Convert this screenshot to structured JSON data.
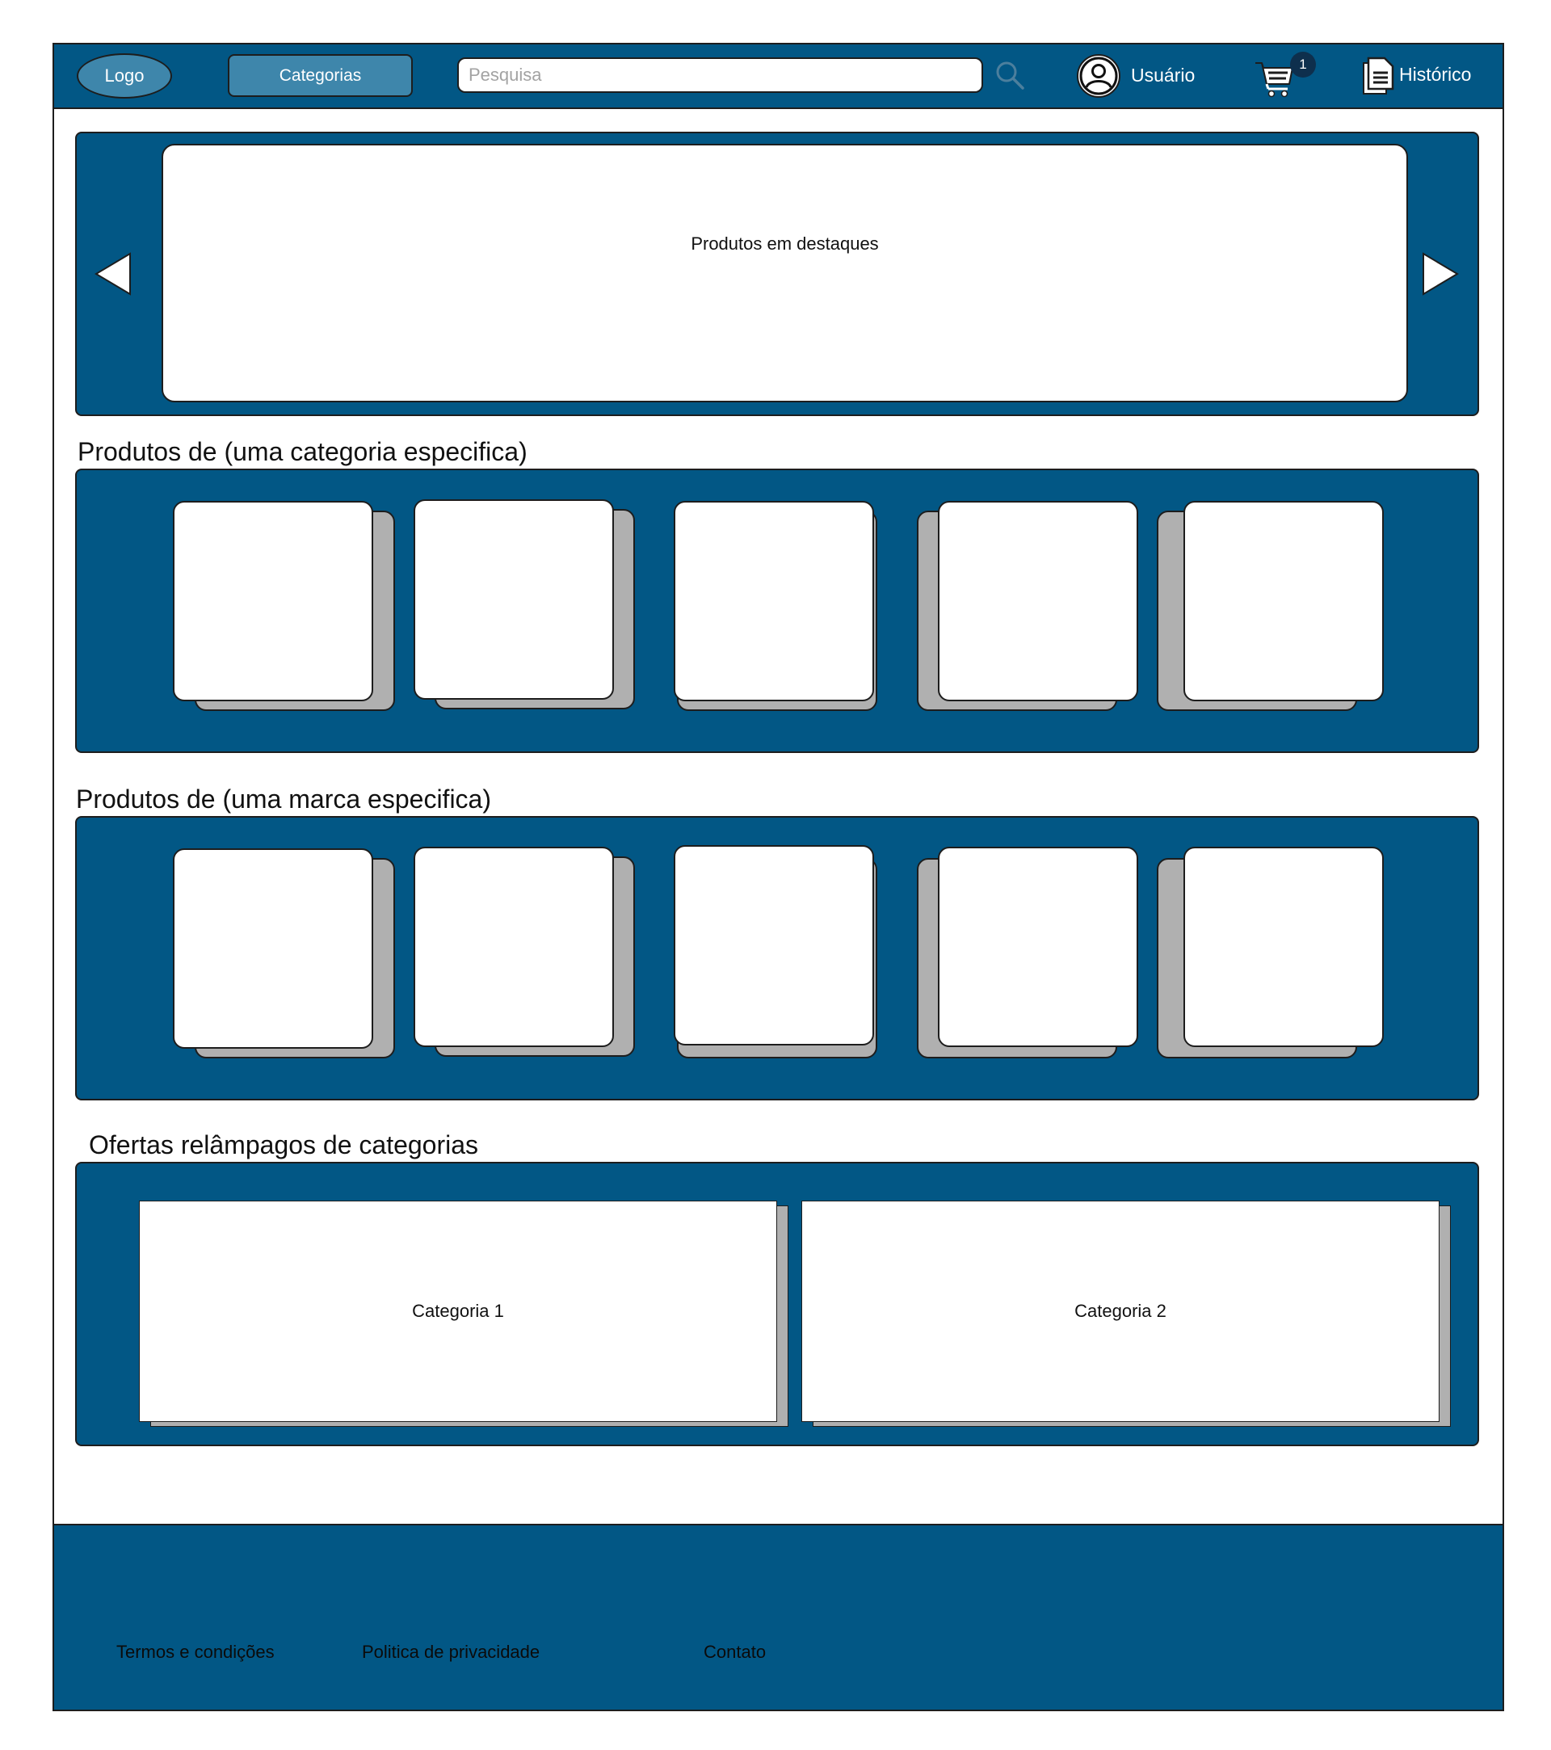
{
  "header": {
    "logo": "Logo",
    "categories_button": "Categorias",
    "search_placeholder": "Pesquisa",
    "user_label": "Usuário",
    "cart_count": "1",
    "history_label": "Histórico"
  },
  "hero": {
    "text": "Produtos em destaques"
  },
  "sections": {
    "category_title": "Produtos de (uma categoria especifica)",
    "brand_title": "Produtos de (uma marca especifica)",
    "flash_title": "Ofertas relâmpagos de categorias"
  },
  "flash": {
    "items": [
      "Categoria 1",
      "Categoria 2"
    ]
  },
  "footer": {
    "terms": "Termos e condições",
    "privacy": "Politica de privacidade",
    "contact": "Contato"
  },
  "colors": {
    "primary": "#025785",
    "button": "#3e86ab",
    "card_shadow": "#b0b0b0"
  }
}
